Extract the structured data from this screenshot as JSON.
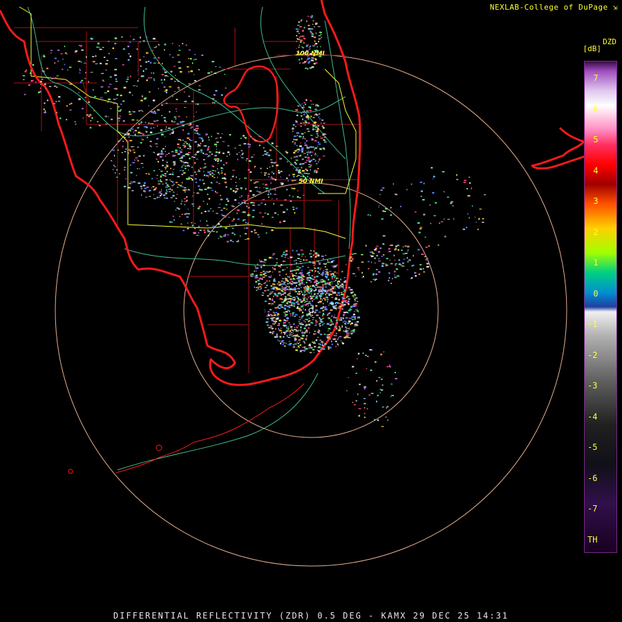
{
  "credit": "NEXLAB-College of DuPage",
  "caption": "DIFFERENTIAL REFLECTIVITY (ZDR) 0.5 DEG - KAMX 29 DEC 25 14:31",
  "rings": {
    "label_100": "100 NMI",
    "label_50": "50 NMI"
  },
  "colorbar": {
    "title": "DZD",
    "unit": "[dB]",
    "labels": [
      "7",
      "6",
      "5",
      "4",
      "3",
      "2",
      "1",
      "0",
      "-1",
      "-2",
      "-3",
      "-4",
      "-5",
      "-6",
      "-7",
      "TH"
    ]
  },
  "colors": {
    "coast": "#ff1a1a",
    "counties": "#b01010",
    "state_line": "#ffff33",
    "roads": "#40c090",
    "rings": "#e8b090",
    "text": "#ffff33"
  }
}
